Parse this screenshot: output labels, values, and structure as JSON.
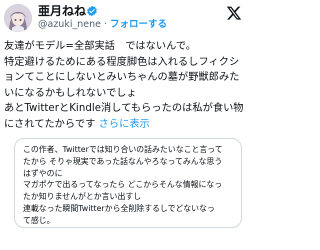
{
  "post": {
    "author": {
      "display_name": "亜月ねね",
      "handle": "@azuki_nene",
      "separator": "·",
      "follow_label": "フォローする",
      "verified": true,
      "avatar_icon": "anime-avatar-icon"
    },
    "platform_icon": "x-logo-icon",
    "body_lines": [
      "友達がモデル=全部実話　ではないんで。",
      "特定避けるためにある程度脚色は入れるしフィクシ",
      "ョンてことにしないとみいちゃんの墓が野獣郎みた",
      "いになるかもしれないでしょ",
      "あとTwitterとKindle消してもらったのは私が食い物",
      "にされてたからです"
    ],
    "more_label": "さらに表示",
    "quote_lines": [
      "この作者、Twitterでは知り合いの話みたいなこと言って",
      "たから そりゃ現実であった話なんやろなってみんな思う",
      "はずやのに",
      "マガポケで出るってなったら どこからそんな情報になっ",
      "たか知りませんがとか言い出すし",
      "連載なった瞬間Twitterから全削除するしでどないなっ",
      "て感じ。"
    ],
    "colors": {
      "link": "#1d9bf0",
      "verified_badge": "#1d9bf0",
      "text": "#0f1419",
      "secondary_text": "#536471",
      "border": "#cfd9de"
    }
  }
}
